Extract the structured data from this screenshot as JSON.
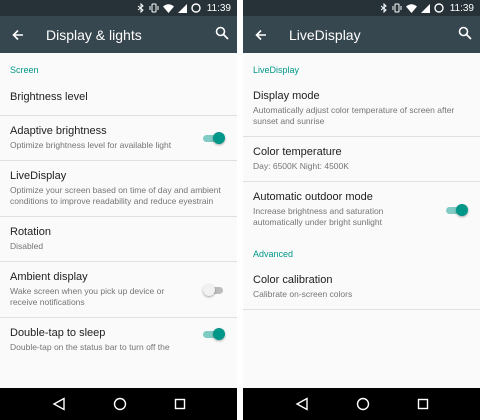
{
  "status_bar": {
    "time": "11:39"
  },
  "left": {
    "toolbar": {
      "title": "Display & lights"
    },
    "section_header": "Screen",
    "prefs": [
      {
        "title": "Brightness level",
        "summary": ""
      },
      {
        "title": "Adaptive brightness",
        "summary": "Optimize brightness level for available light",
        "switch": "on"
      },
      {
        "title": "LiveDisplay",
        "summary": "Optimize your screen based on time of day and ambient conditions to improve readability and reduce eyestrain"
      },
      {
        "title": "Rotation",
        "summary": "Disabled"
      },
      {
        "title": "Ambient display",
        "summary": "Wake screen when you pick up device or receive notifications",
        "switch": "off"
      },
      {
        "title": "Double-tap to sleep",
        "summary": "Double-tap on the status bar to turn off the",
        "switch": "on"
      }
    ]
  },
  "right": {
    "toolbar": {
      "title": "LiveDisplay"
    },
    "section_header_1": "LiveDisplay",
    "prefs": [
      {
        "title": "Display mode",
        "summary": "Automatically adjust color temperature of screen after sunset and sunrise"
      },
      {
        "title": "Color temperature",
        "summary": "Day: 6500K Night: 4500K"
      },
      {
        "title": "Automatic outdoor mode",
        "summary": "Increase brightness and saturation automatically under bright sunlight",
        "switch": "on"
      }
    ],
    "section_header_2": "Advanced",
    "advanced_prefs": [
      {
        "title": "Color calibration",
        "summary": "Calibrate on-screen colors"
      }
    ]
  },
  "icons": {
    "back": "back-arrow-icon",
    "search": "search-icon",
    "nav_back": "nav-back-icon",
    "nav_home": "nav-home-icon",
    "nav_recents": "nav-recents-icon"
  },
  "colors": {
    "accent": "#009688",
    "toolbar": "#37474f",
    "status_bar": "#263238"
  }
}
